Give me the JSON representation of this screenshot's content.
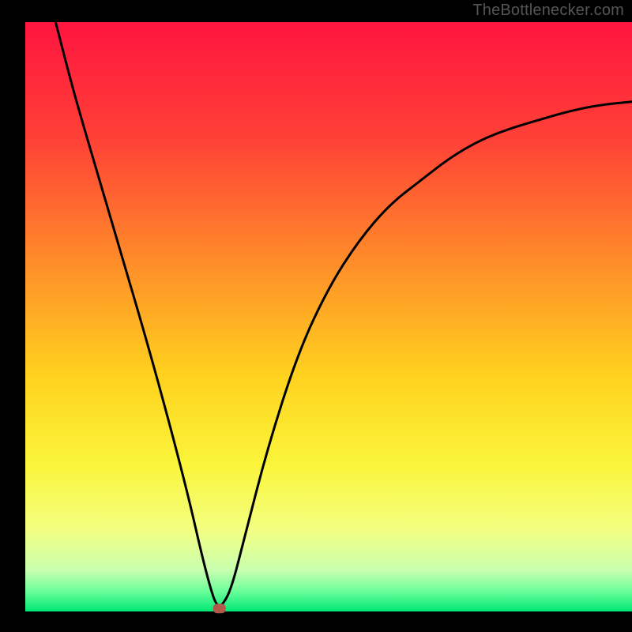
{
  "attribution": "TheBottlenecker.com",
  "colors": {
    "frame": "#000000",
    "gradient_stops": [
      {
        "offset": 0.0,
        "color": "#ff153f"
      },
      {
        "offset": 0.2,
        "color": "#ff4136"
      },
      {
        "offset": 0.4,
        "color": "#ff8a2a"
      },
      {
        "offset": 0.6,
        "color": "#ffd21e"
      },
      {
        "offset": 0.75,
        "color": "#faf53a"
      },
      {
        "offset": 0.86,
        "color": "#f3ff80"
      },
      {
        "offset": 0.93,
        "color": "#c9ffb0"
      },
      {
        "offset": 0.965,
        "color": "#6eff9a"
      },
      {
        "offset": 1.0,
        "color": "#00e876"
      }
    ],
    "curve": "#000000",
    "marker": "#b15a4a"
  },
  "chart_data": {
    "type": "line",
    "title": "",
    "xlabel": "",
    "ylabel": "",
    "xlim": [
      0,
      100
    ],
    "ylim": [
      0,
      100
    ],
    "legend": false,
    "grid": false,
    "notes": "V-shaped bottleneck curve over a vertical red→green gradient. x is normalized component-ratio axis; y is bottleneck percentage (high=red=bad, low=green=good). Curve minimum (~0%) occurs near the marker at x≈32. Values are estimated from pixel positions.",
    "series": [
      {
        "name": "bottleneck_curve",
        "x": [
          5,
          8,
          12,
          16,
          20,
          24,
          27,
          29,
          30.5,
          31.5,
          32.5,
          34,
          36,
          40,
          45,
          50,
          55,
          60,
          65,
          70,
          75,
          80,
          85,
          90,
          95,
          100
        ],
        "y": [
          100,
          88,
          74,
          60,
          46,
          31,
          19,
          10,
          4,
          1,
          1,
          4,
          12,
          28,
          44,
          55,
          63,
          69,
          73,
          77,
          80,
          82,
          83.5,
          85,
          86,
          86.5
        ]
      }
    ],
    "marker": {
      "x": 32,
      "y": 0.5,
      "shape": "rounded-rect"
    }
  }
}
